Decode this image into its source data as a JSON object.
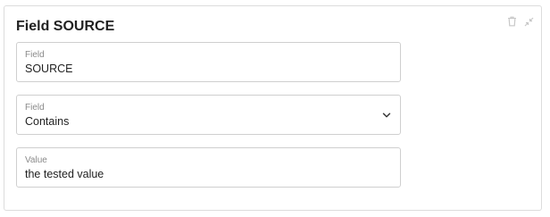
{
  "card": {
    "title": "Field SOURCE",
    "actions": {
      "delete_icon": "trash-icon",
      "collapse_icon": "collapse-arrows-icon"
    }
  },
  "fields": [
    {
      "label": "Field",
      "value": "SOURCE",
      "type": "text"
    },
    {
      "label": "Field",
      "value": "Contains",
      "type": "select",
      "icon": "chevron-down-icon"
    },
    {
      "label": "Value",
      "value": "the tested value",
      "type": "text"
    }
  ]
}
